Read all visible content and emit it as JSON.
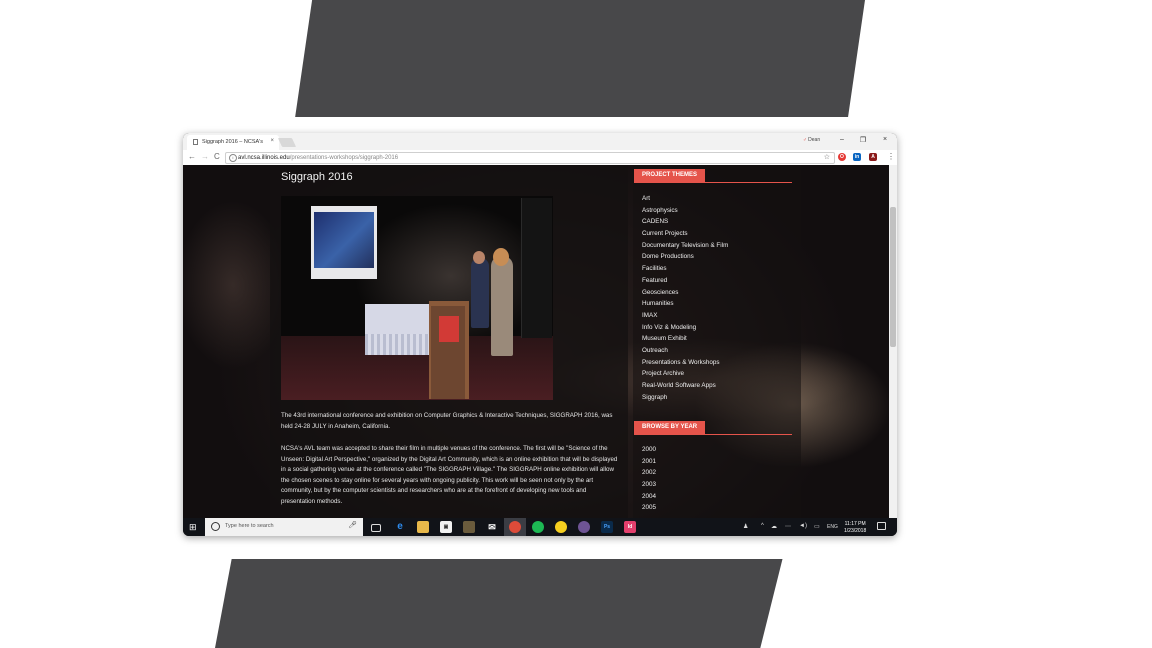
{
  "browser": {
    "tab_title": "Siggraph 2016 – NCSA's",
    "tab_close": "×",
    "user_label": "Dean",
    "url_host": "avl.ncsa.illinois.edu",
    "url_path": "/presentations-workshops/siggraph-2016",
    "nav_back": "←",
    "nav_forward": "→",
    "nav_reload": "C",
    "star": "☆",
    "menu": "⋮",
    "win_min": "–",
    "win_max": "❐",
    "win_close": "×"
  },
  "page": {
    "title": "Siggraph 2016",
    "paragraphs": [
      "The 43rd international conference and exhibition on Computer Graphics & Interactive Techniques, SIGGRAPH 2016, was held 24-28 JULY in Anaheim, California.",
      "NCSA's AVL team was accepted to share their film in multiple venues of the conference. The first will be \"Science of the Unseen: Digital Art Perspective,\" organized by the Digital Art Community, which is an online exhibition that will be displayed in a social gathering venue at the conference called \"The SIGGRAPH Village.\" The SIGGRAPH online exhibition will allow the chosen scenes to stay online for several years with ongoing publicity. This work will be seen not only by the art community, but by the computer scientists and researchers who are at the forefront of developing new tools and presentation methods."
    ]
  },
  "sidebar": {
    "themes_heading": "PROJECT THEMES",
    "themes": [
      "Art",
      "Astrophysics",
      "CADENS",
      "Current Projects",
      "Documentary Television & Film",
      "Dome Productions",
      "Facilities",
      "Featured",
      "Geosciences",
      "Humanities",
      "IMAX",
      "Info Viz & Modeling",
      "Museum Exhibit",
      "Outreach",
      "Presentations & Workshops",
      "Project Archive",
      "Real-World Software Apps",
      "Siggraph"
    ],
    "years_heading": "BROWSE BY YEAR",
    "years": [
      "2000",
      "2001",
      "2002",
      "2003",
      "2004",
      "2005"
    ]
  },
  "taskbar": {
    "search_placeholder": "Type here to search",
    "language": "ENG",
    "time": "11:17 PM",
    "date": "1/23/2018"
  },
  "colors": {
    "accent": "#e5544b",
    "taskbar": "#111318",
    "decor": "#48484a"
  }
}
